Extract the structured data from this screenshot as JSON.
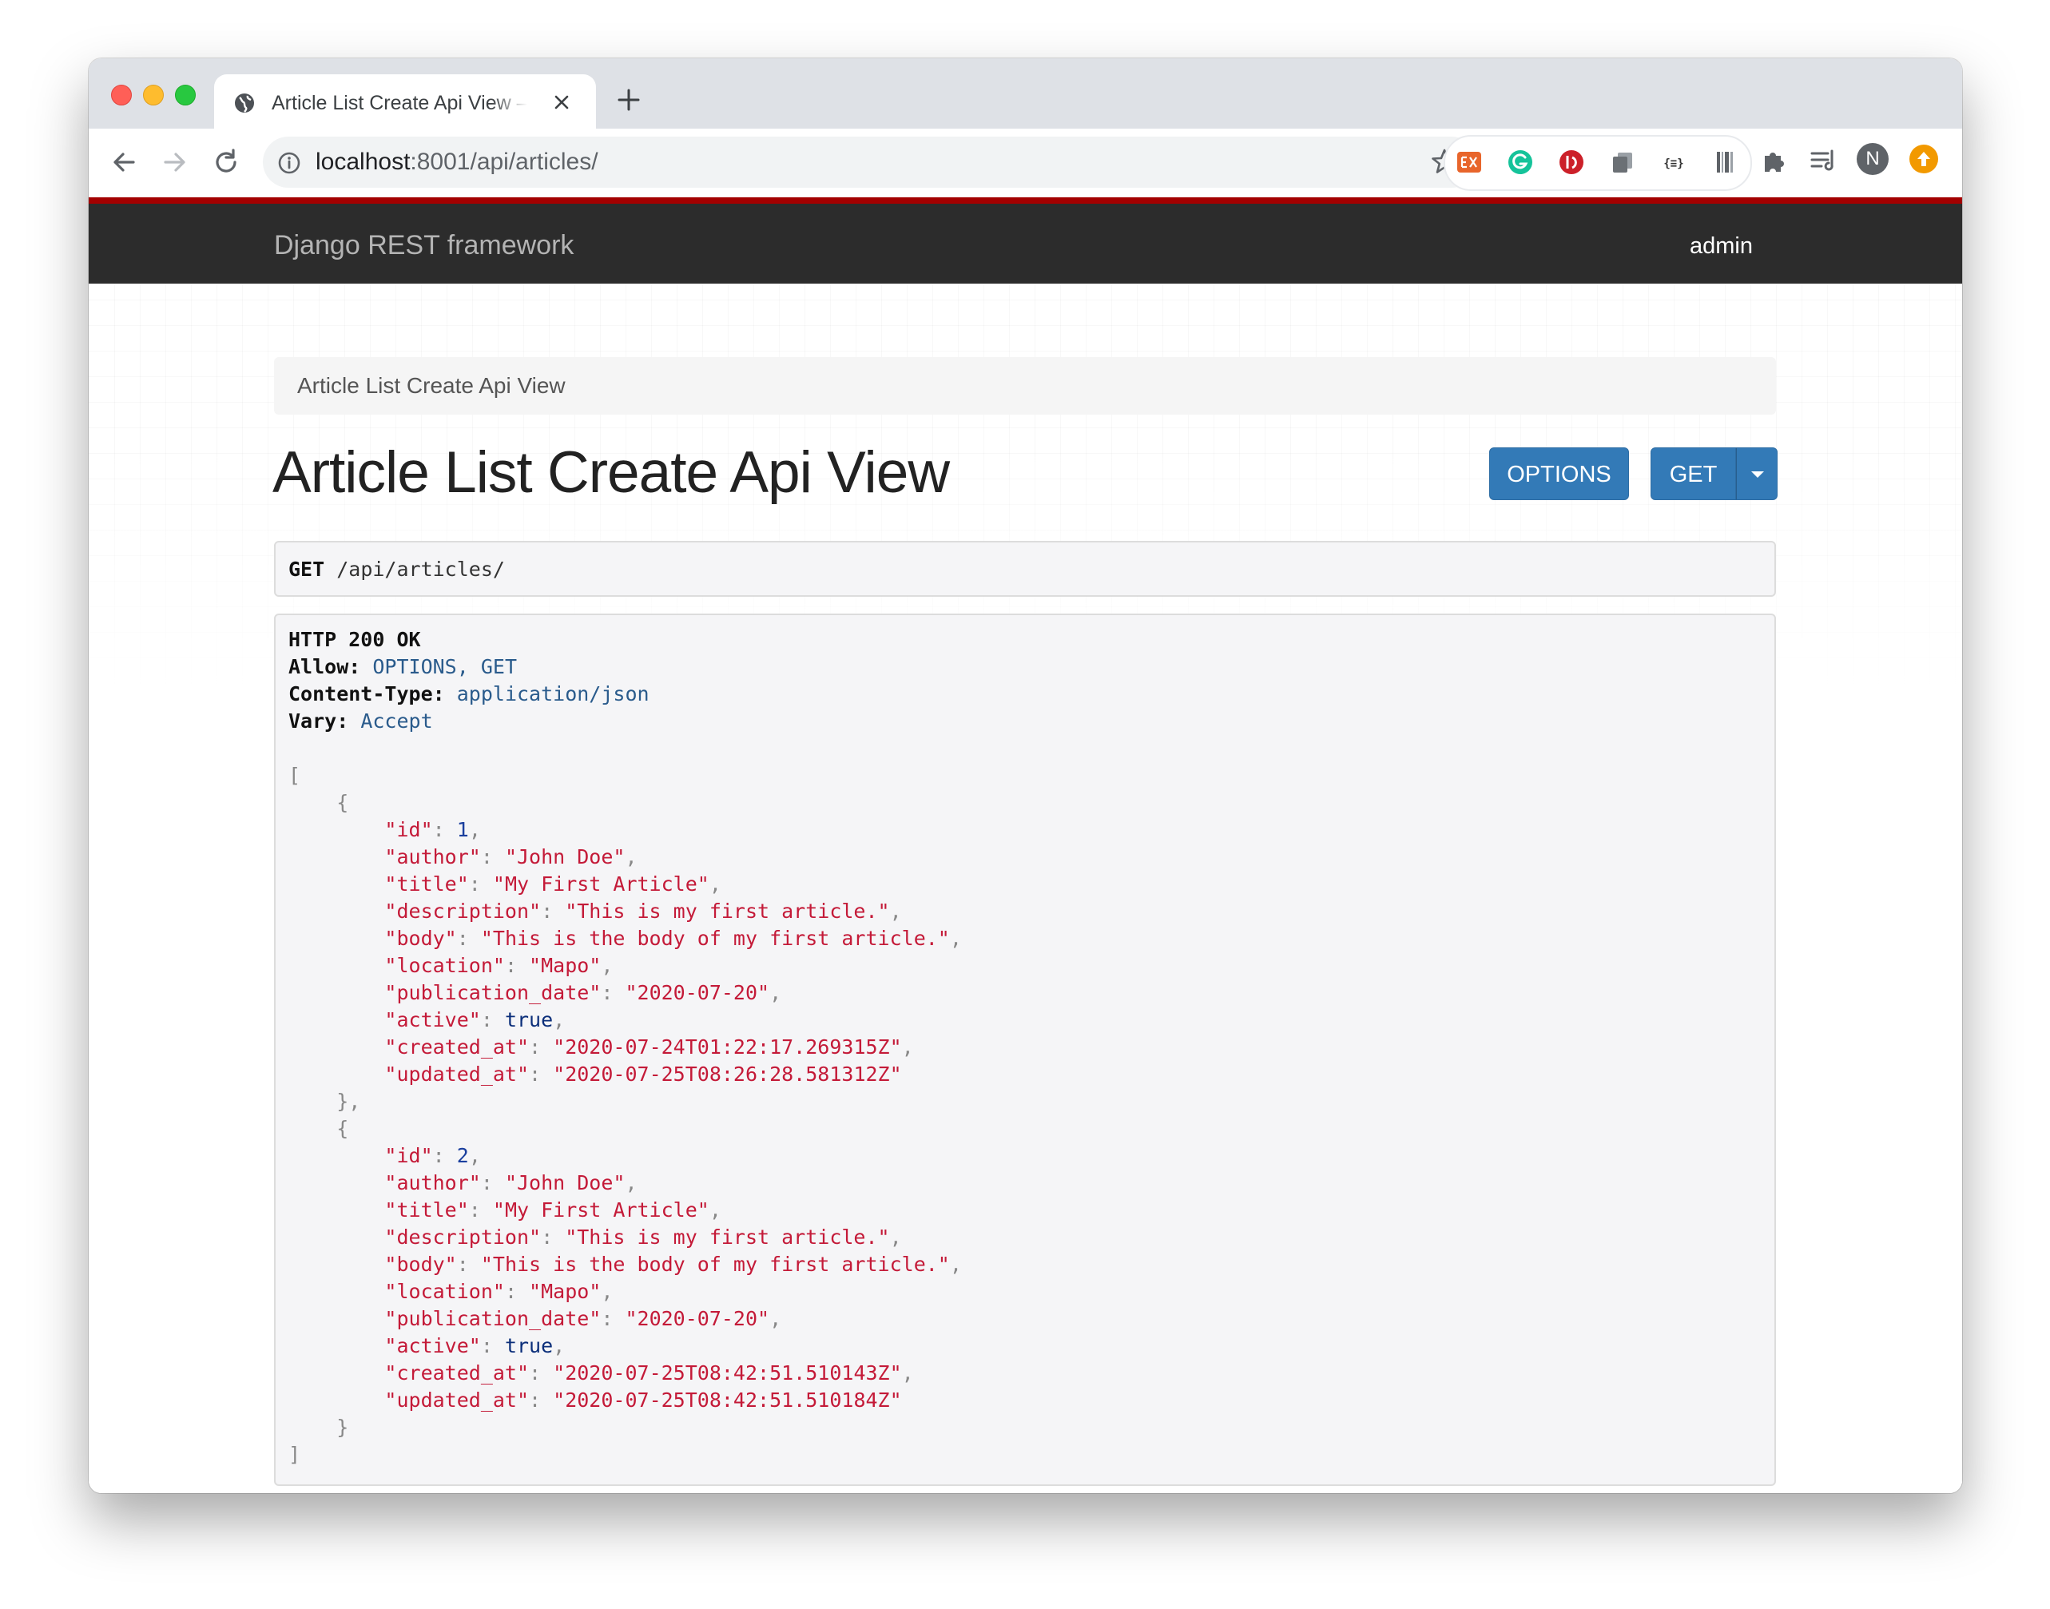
{
  "browser": {
    "tab_title": "Article List Create Api View – Django REST framework",
    "url_host": "localhost",
    "url_rest": ":8001/api/articles/",
    "profile_initial": "N",
    "extensions": [
      "ex-extension-icon",
      "grammarly-icon",
      "lastpass-icon",
      "copy-extension-icon",
      "json-formatter-icon",
      "barcode-extension-icon",
      "puzzle-icon"
    ],
    "colors": {
      "tabstrip": "#dee1e6",
      "omnibox": "#f1f3f4"
    }
  },
  "navbar": {
    "brand": "Django REST framework",
    "user": "admin",
    "colors": {
      "bar": "#2c2c2c",
      "accent": "#a30000"
    }
  },
  "breadcrumb": {
    "current": "Article List Create Api View"
  },
  "page": {
    "title": "Article List Create Api View",
    "options_button": "OPTIONS",
    "get_button": "GET",
    "button_color": "#337ab7"
  },
  "request": {
    "method": "GET",
    "path": "/api/articles/"
  },
  "response": {
    "status": "HTTP 200 OK",
    "headers": [
      {
        "name": "Allow:",
        "value": "OPTIONS, GET"
      },
      {
        "name": "Content-Type:",
        "value": "application/json"
      },
      {
        "name": "Vary:",
        "value": "Accept"
      }
    ],
    "articles": [
      {
        "id": "1",
        "author": "\"John Doe\"",
        "title": "\"My First Article\"",
        "description": "\"This is my first article.\"",
        "body": "\"This is the body of my first article.\"",
        "location": "\"Mapo\"",
        "publication_date": "\"2020-07-20\"",
        "active": "true",
        "created_at": "\"2020-07-24T01:22:17.269315Z\"",
        "updated_at": "\"2020-07-25T08:26:28.581312Z\""
      },
      {
        "id": "2",
        "author": "\"John Doe\"",
        "title": "\"My First Article\"",
        "description": "\"This is my first article.\"",
        "body": "\"This is the body of my first article.\"",
        "location": "\"Mapo\"",
        "publication_date": "\"2020-07-20\"",
        "active": "true",
        "created_at": "\"2020-07-25T08:42:51.510143Z\"",
        "updated_at": "\"2020-07-25T08:42:51.510184Z\""
      }
    ]
  }
}
